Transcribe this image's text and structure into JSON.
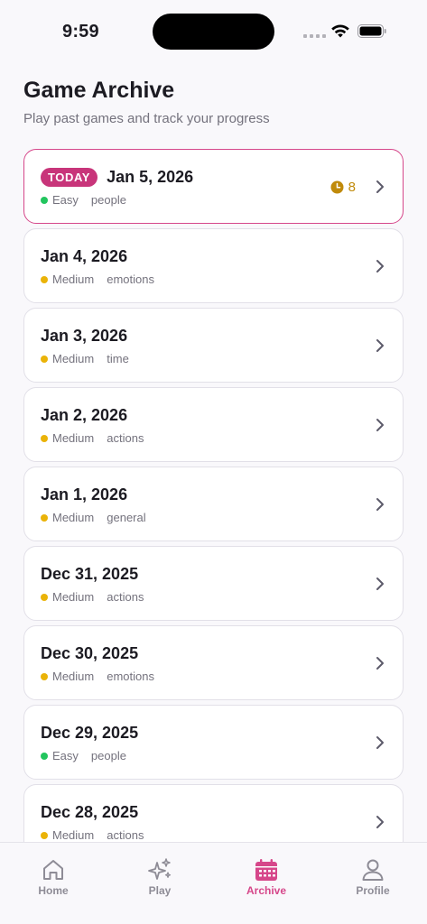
{
  "status_bar": {
    "time": "9:59"
  },
  "header": {
    "title": "Game Archive",
    "subtitle": "Play past games and track your progress"
  },
  "games": [
    {
      "badge": "TODAY",
      "date": "Jan 5, 2026",
      "difficulty": "Easy",
      "category": "people",
      "timer": "8"
    },
    {
      "date": "Jan 4, 2026",
      "difficulty": "Medium",
      "category": "emotions"
    },
    {
      "date": "Jan 3, 2026",
      "difficulty": "Medium",
      "category": "time"
    },
    {
      "date": "Jan 2, 2026",
      "difficulty": "Medium",
      "category": "actions"
    },
    {
      "date": "Jan 1, 2026",
      "difficulty": "Medium",
      "category": "general"
    },
    {
      "date": "Dec 31, 2025",
      "difficulty": "Medium",
      "category": "actions"
    },
    {
      "date": "Dec 30, 2025",
      "difficulty": "Medium",
      "category": "emotions"
    },
    {
      "date": "Dec 29, 2025",
      "difficulty": "Easy",
      "category": "people"
    },
    {
      "date": "Dec 28, 2025",
      "difficulty": "Medium",
      "category": "actions"
    }
  ],
  "tabs": [
    {
      "label": "Home",
      "icon": "home-icon"
    },
    {
      "label": "Play",
      "icon": "sparkles-icon"
    },
    {
      "label": "Archive",
      "icon": "calendar-icon",
      "active": true
    },
    {
      "label": "Profile",
      "icon": "user-icon"
    }
  ],
  "colors": {
    "accent": "#d6478a",
    "easy": "#22c55e",
    "medium": "#eab308",
    "timer": "#c08a0a"
  }
}
